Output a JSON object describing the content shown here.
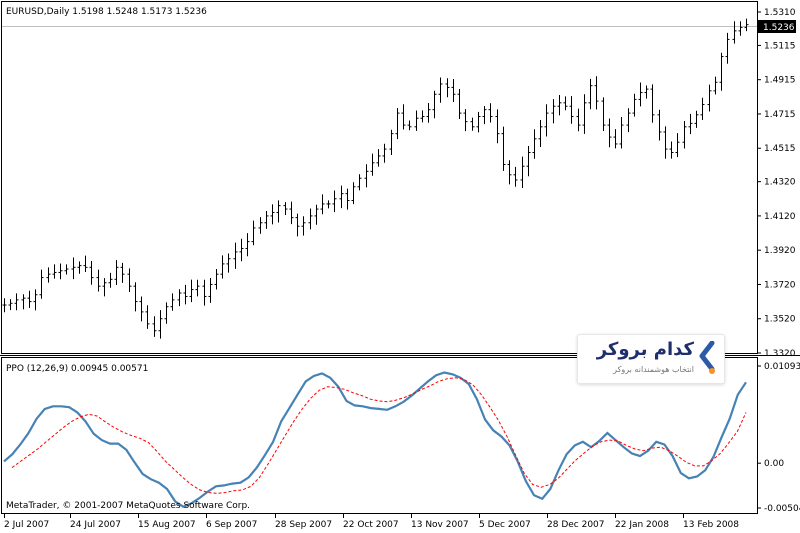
{
  "main_chart": {
    "header": "EURUSD,Daily  1.5198 1.5248 1.5173 1.5236",
    "price_labels": [
      "1.5310",
      "1.5115",
      "1.4915",
      "1.4715",
      "1.4515",
      "1.4320",
      "1.4120",
      "1.3920",
      "1.3720",
      "1.3520",
      "1.3320"
    ],
    "current_price": "1.5236"
  },
  "indicator": {
    "header": "PPO (12,26,9) 0.00945 0.00571",
    "scale_labels": [
      "0.01093",
      "0.00",
      "-0.00504"
    ],
    "copyright": "MetaTrader, © 2001-2007 MetaQuotes Software Corp."
  },
  "time_axis": [
    "2 Jul 2007",
    "24 Jul 2007",
    "15 Aug 2007",
    "6 Sep 2007",
    "28 Sep 2007",
    "22 Oct 2007",
    "13 Nov 2007",
    "5 Dec 2007",
    "28 Dec 2007",
    "22 Jan 2008",
    "13 Feb 2008"
  ],
  "watermark": {
    "title": "کدام بروکر",
    "subtitle": "انتخاب هوشمندانه بروکر"
  },
  "colors": {
    "price_bars": "#000000",
    "ppo_line": "#4682b4",
    "signal_line": "#ff0000",
    "current_price_line": "#c0c0c0",
    "brand_blue": "#2b5ba8",
    "brand_orange": "#f7931e"
  },
  "chart_data": [
    {
      "type": "ohlc",
      "series_label": "EURUSD,Daily",
      "y_range": [
        1.332,
        1.531
      ],
      "x_categories": [
        "2 Jul 2007",
        "24 Jul 2007",
        "15 Aug 2007",
        "6 Sep 2007",
        "28 Sep 2007",
        "22 Oct 2007",
        "13 Nov 2007",
        "5 Dec 2007",
        "28 Dec 2007",
        "22 Jan 2008",
        "13 Feb 2008"
      ],
      "closes": [
        1.36,
        1.361,
        1.363,
        1.364,
        1.362,
        1.366,
        1.376,
        1.378,
        1.379,
        1.38,
        1.381,
        1.382,
        1.383,
        1.382,
        1.376,
        1.371,
        1.373,
        1.375,
        1.382,
        1.378,
        1.371,
        1.362,
        1.356,
        1.349,
        1.345,
        1.352,
        1.359,
        1.363,
        1.367,
        1.365,
        1.369,
        1.371,
        1.365,
        1.372,
        1.378,
        1.384,
        1.387,
        1.391,
        1.393,
        1.397,
        1.405,
        1.408,
        1.412,
        1.414,
        1.418,
        1.416,
        1.411,
        1.406,
        1.408,
        1.412,
        1.416,
        1.419,
        1.419,
        1.422,
        1.425,
        1.421,
        1.429,
        1.434,
        1.438,
        1.443,
        1.447,
        1.451,
        1.46,
        1.472,
        1.465,
        1.464,
        1.469,
        1.47,
        1.474,
        1.483,
        1.489,
        1.487,
        1.483,
        1.472,
        1.467,
        1.464,
        1.47,
        1.474,
        1.47,
        1.46,
        1.442,
        1.436,
        1.433,
        1.441,
        1.449,
        1.457,
        1.464,
        1.472,
        1.476,
        1.478,
        1.476,
        1.47,
        1.465,
        1.478,
        1.488,
        1.479,
        1.465,
        1.458,
        1.454,
        1.465,
        1.472,
        1.48,
        1.484,
        1.486,
        1.471,
        1.461,
        1.451,
        1.449,
        1.455,
        1.464,
        1.466,
        1.471,
        1.477,
        1.485,
        1.49,
        1.505,
        1.515,
        1.52,
        1.522,
        1.5236
      ]
    },
    {
      "type": "line",
      "title": "PPO (12,26,9)",
      "y_range": [
        -0.00504,
        0.01093
      ],
      "series": [
        {
          "name": "PPO",
          "values": [
            0.0002,
            0.001,
            0.0021,
            0.0034,
            0.005,
            0.0061,
            0.0064,
            0.0064,
            0.0063,
            0.0057,
            0.0047,
            0.0033,
            0.0026,
            0.0022,
            0.0022,
            0.0015,
            0.0001,
            -0.0012,
            -0.0018,
            -0.0022,
            -0.0029,
            -0.0043,
            -0.0049,
            -0.0045,
            -0.0039,
            -0.0032,
            -0.0026,
            -0.0025,
            -0.0023,
            -0.0022,
            -0.0016,
            -0.0005,
            0.0009,
            0.0024,
            0.0047,
            0.0062,
            0.0077,
            0.0092,
            0.0098,
            0.0101,
            0.0096,
            0.0086,
            0.007,
            0.0065,
            0.0064,
            0.0062,
            0.0061,
            0.006,
            0.0064,
            0.0069,
            0.0076,
            0.0084,
            0.0092,
            0.0099,
            0.0102,
            0.01,
            0.0096,
            0.0089,
            0.0072,
            0.0049,
            0.0037,
            0.003,
            0.002,
            0.0002,
            -0.002,
            -0.0036,
            -0.004,
            -0.0029,
            -0.0008,
            0.001,
            0.002,
            0.0024,
            0.0018,
            0.0025,
            0.0034,
            0.0026,
            0.0018,
            0.0011,
            0.0008,
            0.0014,
            0.0024,
            0.0021,
            0.0008,
            -0.0011,
            -0.0017,
            -0.0015,
            -0.0008,
            0.0007,
            0.0029,
            0.005,
            0.0077,
            0.0091
          ]
        },
        {
          "name": "Signal",
          "values": [
            -0.0005,
            0.0002,
            0.0009,
            0.0016,
            0.0024,
            0.0032,
            0.004,
            0.0047,
            0.0052,
            0.0055,
            0.0053,
            0.0046,
            0.004,
            0.0035,
            0.0031,
            0.0028,
            0.0023,
            0.0013,
            0.0002,
            -0.0007,
            -0.0016,
            -0.0024,
            -0.003,
            -0.0033,
            -0.0034,
            -0.0033,
            -0.0031,
            -0.003,
            -0.0026,
            -0.0016,
            -0.0001,
            0.0015,
            0.0031,
            0.0047,
            0.0061,
            0.0073,
            0.0082,
            0.0086,
            0.0085,
            0.0083,
            0.0079,
            0.0076,
            0.0072,
            0.007,
            0.0069,
            0.0071,
            0.0074,
            0.0078,
            0.0083,
            0.0087,
            0.0092,
            0.0095,
            0.0096,
            0.0094,
            0.0088,
            0.0077,
            0.0063,
            0.0048,
            0.003,
            0.0009,
            -0.0011,
            -0.0024,
            -0.0027,
            -0.0024,
            -0.0017,
            -0.0007,
            0.0003,
            0.0011,
            0.0019,
            0.0024,
            0.0026,
            0.0025,
            0.002,
            0.0016,
            0.0014,
            0.0017,
            0.0018,
            0.0014,
            0.0008,
            0.0001,
            -0.0003,
            -0.0003,
            0.0003,
            0.0011,
            0.0023,
            0.0036,
            0.0057
          ]
        }
      ]
    }
  ]
}
